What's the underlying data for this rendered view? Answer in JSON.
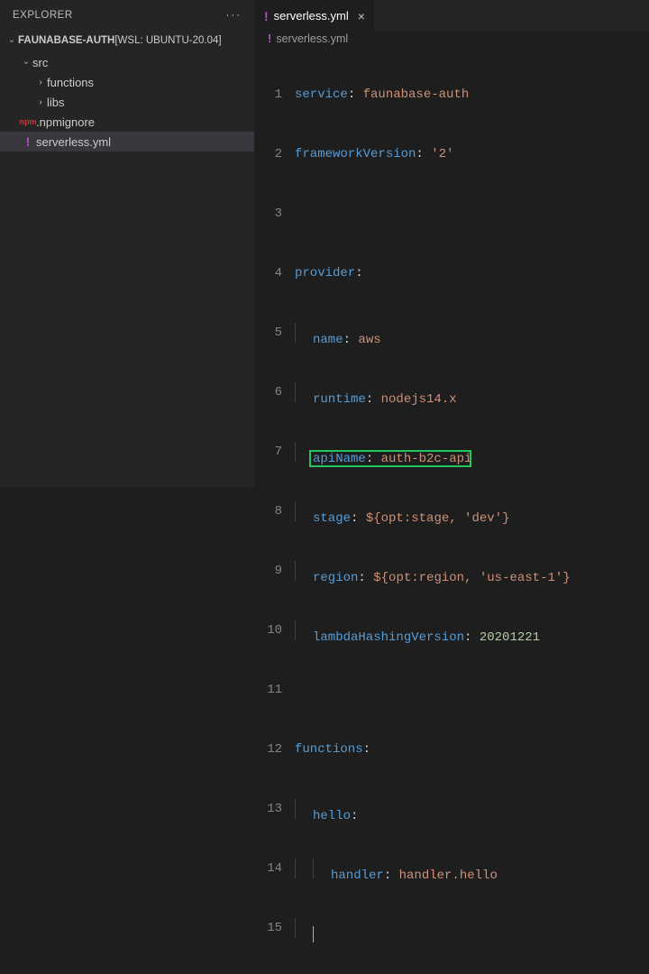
{
  "explorer": {
    "title": "EXPLORER",
    "workspace_name": "FAUNABASE-AUTH",
    "workspace_sub": " [WSL: UBUNTU-20.04]",
    "tree": {
      "src": {
        "label": "src"
      },
      "functions": {
        "label": "functions"
      },
      "libs": {
        "label": "libs"
      },
      "npmignore": {
        "label": ".npmignore",
        "icon": "npm"
      },
      "serverless": {
        "label": "serverless.yml",
        "icon": "!"
      }
    }
  },
  "tab": {
    "label": "serverless.yml",
    "close": "×"
  },
  "breadcrumb": {
    "label": "serverless.yml"
  },
  "code": {
    "line1_key": "service",
    "line1_val": "faunabase-auth",
    "line2_key": "frameworkVersion",
    "line2_val": "'2'",
    "line4_key": "provider",
    "line5_key": "name",
    "line5_val": "aws",
    "line6_key": "runtime",
    "line6_val": "nodejs14.x",
    "line7_key": "apiName",
    "line7_val": "auth-b2c-api",
    "line8_key": "stage",
    "line8_val_a": "${opt:stage, ",
    "line8_val_b": "'dev'",
    "line8_val_c": "}",
    "line9_key": "region",
    "line9_val_a": "${opt:region, ",
    "line9_val_b": "'us-east-1'",
    "line9_val_c": "}",
    "line10_key": "lambdaHashingVersion",
    "line10_val": "20201221",
    "line12_key": "functions",
    "line13_key": "hello",
    "line14_key": "handler",
    "line14_val": "handler.hello"
  },
  "line_numbers": [
    "1",
    "2",
    "3",
    "4",
    "5",
    "6",
    "7",
    "8",
    "9",
    "10",
    "11",
    "12",
    "13",
    "14",
    "15"
  ]
}
